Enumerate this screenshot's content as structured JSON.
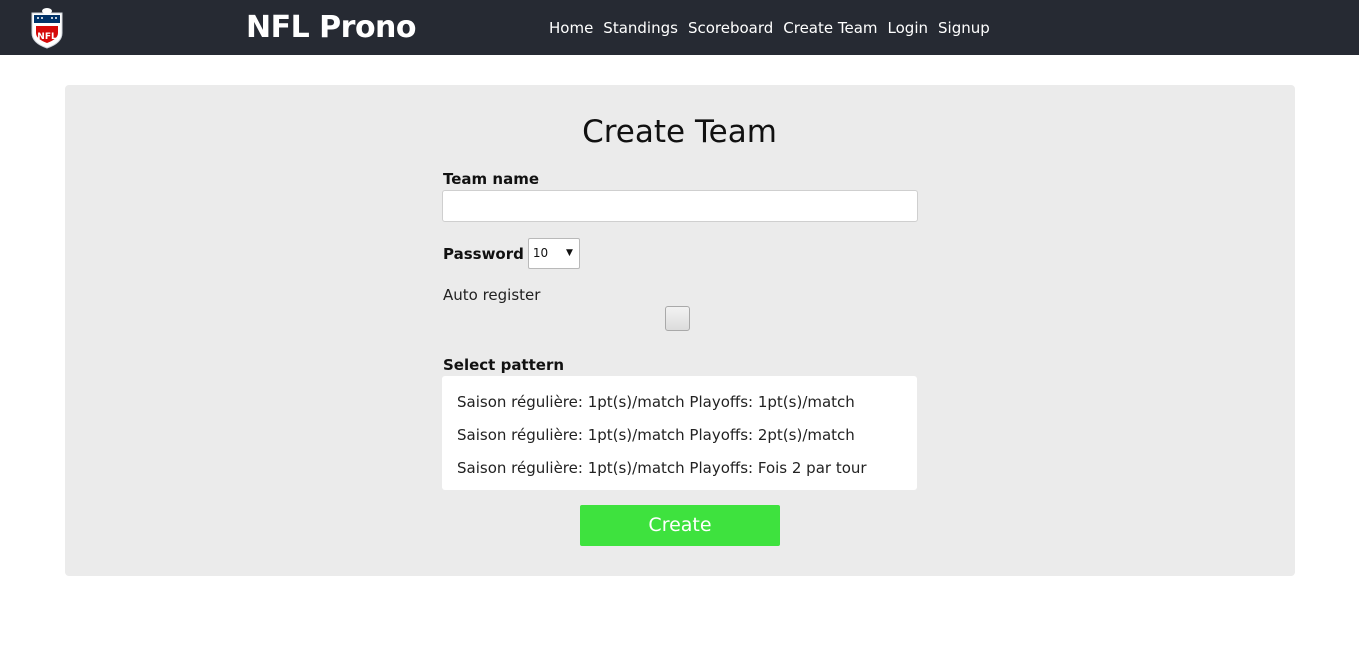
{
  "header": {
    "logo_text": "NFL",
    "brand": "NFL Prono",
    "nav": [
      "Home",
      "Standings",
      "Scoreboard",
      "Create Team",
      "Login",
      "Signup"
    ]
  },
  "form": {
    "title": "Create Team",
    "team_name_label": "Team name",
    "team_name_value": "",
    "password_label": "Password",
    "password_selected": "10",
    "auto_register_label": "Auto register",
    "auto_register_checked": false,
    "pattern_label": "Select pattern",
    "patterns": [
      "Saison régulière: 1pt(s)/match Playoffs: 1pt(s)/match",
      "Saison régulière: 1pt(s)/match Playoffs: 2pt(s)/match",
      "Saison régulière: 1pt(s)/match Playoffs: Fois 2 par tour"
    ],
    "submit_label": "Create"
  },
  "colors": {
    "navbar_bg": "#262a33",
    "panel_bg": "#ebebeb",
    "button_green": "#3ee23e",
    "nfl_blue": "#013369",
    "nfl_red": "#d50a0a"
  }
}
